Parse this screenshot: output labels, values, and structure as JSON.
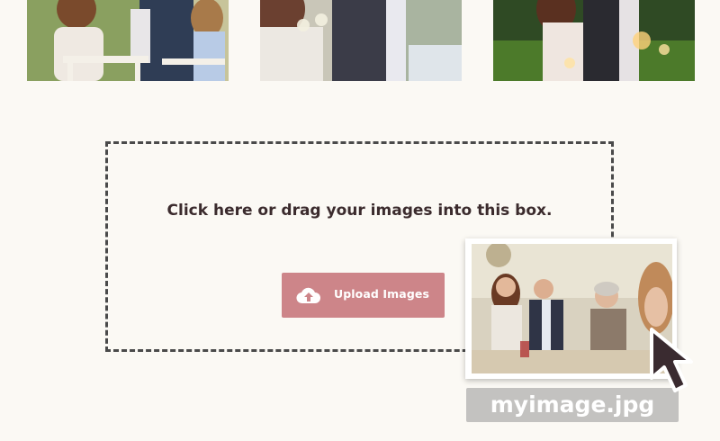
{
  "gallery": {
    "thumbnails": [
      {
        "id": "photo-1"
      },
      {
        "id": "photo-2"
      },
      {
        "id": "photo-3"
      }
    ]
  },
  "dropzone": {
    "instruction": "Click here or drag your images into this box.",
    "upload_button_label": "Upload Images",
    "upload_icon": "cloud-upload-icon"
  },
  "dragged_file": {
    "filename": "myimage.jpg",
    "cursor_icon": "pointer-cursor-icon"
  },
  "colors": {
    "background": "#fbf9f4",
    "button": "#cd8589",
    "text": "#3b2b2d"
  }
}
